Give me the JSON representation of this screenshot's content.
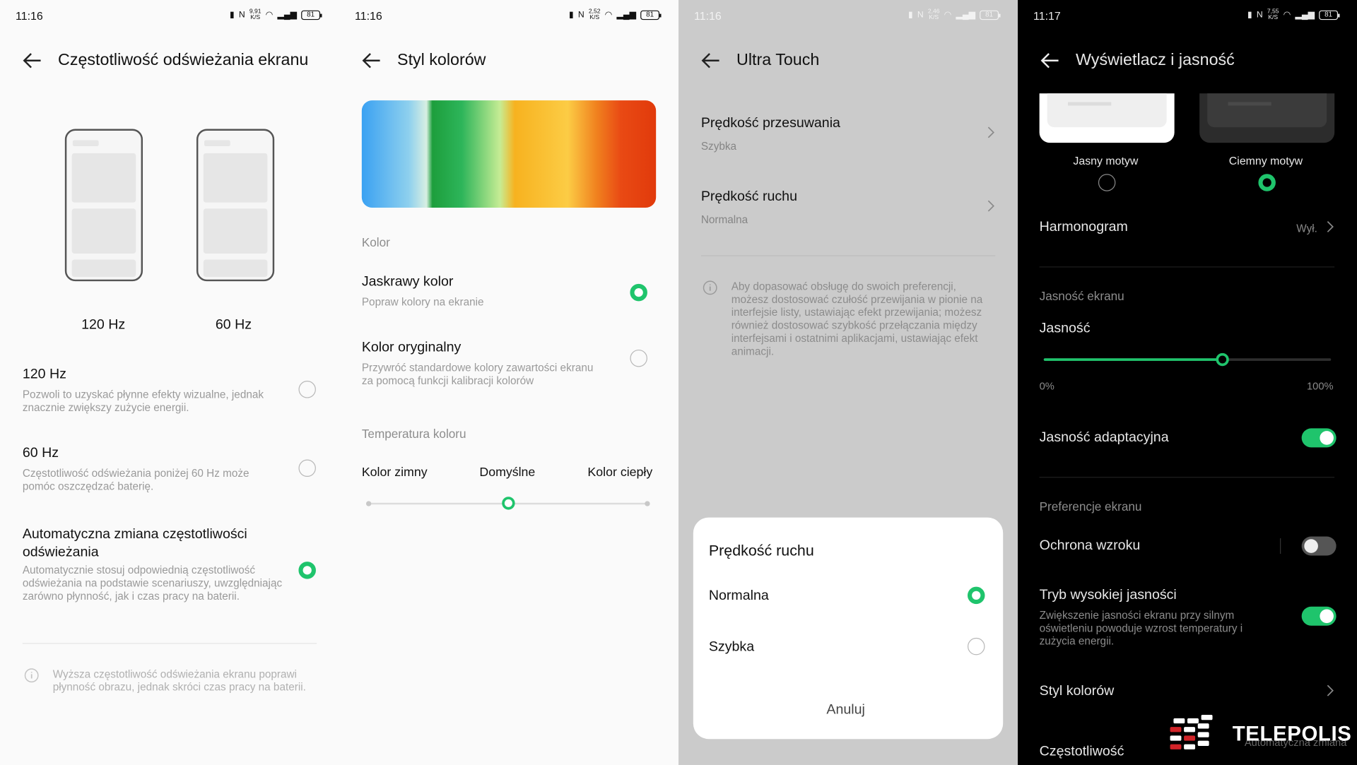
{
  "colors": {
    "accent": "#1fc46c",
    "dark_bg": "#000000",
    "light_bg": "#fafafa",
    "dimmed_bg": "#cbcbcb"
  },
  "p1": {
    "time": "11:16",
    "speed": "9,91",
    "speed_unit": "K/S",
    "battery": "81",
    "title": "Częstotliwość odświeżania ekranu",
    "phone_labels": [
      "120 Hz",
      "60 Hz"
    ],
    "options": [
      {
        "title": "120 Hz",
        "sub": "Pozwoli to uzyskać płynne efekty wizualne, jednak znacznie zwiększy zużycie energii.",
        "selected": false
      },
      {
        "title": "60 Hz",
        "sub": "Częstotliwość odświeżania poniżej 60 Hz może pomóc oszczędzać baterię.",
        "selected": false
      },
      {
        "title": "Automatyczna zmiana częstotliwości odświeżania",
        "sub": "Automatycznie stosuj odpowiednią częstotliwość odświeżania na podstawie scenariuszy, uwzględniając zarówno płynność, jak i czas pracy na baterii.",
        "selected": true
      }
    ],
    "note": "Wyższa częstotliwość odświeżania ekranu poprawi płynność obrazu, jednak skróci czas pracy na baterii."
  },
  "p2": {
    "time": "11:16",
    "speed": "2,52",
    "speed_unit": "K/S",
    "battery": "81",
    "title": "Styl kolorów",
    "section_color": "Kolor",
    "options": [
      {
        "title": "Jaskrawy kolor",
        "sub": "Popraw kolory na ekranie",
        "selected": true
      },
      {
        "title": "Kolor oryginalny",
        "sub": "Przywróć standardowe kolory zawartości ekranu za pomocą funkcji kalibracji kolorów",
        "selected": false
      }
    ],
    "section_temp": "Temperatura koloru",
    "temp_labels": [
      "Kolor zimny",
      "Domyślne",
      "Kolor ciepły"
    ],
    "temp_value": 0.5
  },
  "p3": {
    "time": "11:16",
    "speed": "2,46",
    "speed_unit": "K/S",
    "battery": "81",
    "title": "Ultra Touch",
    "rows": [
      {
        "title": "Prędkość przesuwania",
        "value": "Szybka"
      },
      {
        "title": "Prędkość ruchu",
        "value": "Normalna"
      }
    ],
    "note": "Aby dopasować obsługę do swoich preferencji, możesz dostosować czułość przewijania w pionie na interfejsie listy, ustawiając efekt przewijania; możesz również dostosować szybkość przełączania między interfejsami i ostatnimi aplikacjami, ustawiając efekt animacji.",
    "dialog": {
      "title": "Prędkość ruchu",
      "options": [
        {
          "label": "Normalna",
          "selected": true
        },
        {
          "label": "Szybka",
          "selected": false
        }
      ],
      "cancel": "Anuluj"
    }
  },
  "p4": {
    "time": "11:17",
    "speed": "7,55",
    "speed_unit": "K/S",
    "battery": "81",
    "title": "Wyświetlacz i jasność",
    "themes": [
      {
        "label": "Jasny motyw",
        "selected": false
      },
      {
        "label": "Ciemny motyw",
        "selected": true
      }
    ],
    "schedule": {
      "title": "Harmonogram",
      "value": "Wył."
    },
    "section_brightness": "Jasność ekranu",
    "brightness_label": "Jasność",
    "brightness_value": 0.62,
    "brightness_min": "0%",
    "brightness_max": "100%",
    "adaptive": {
      "title": "Jasność adaptacyjna",
      "on": true
    },
    "section_prefs": "Preferencje ekranu",
    "eye": {
      "title": "Ochrona wzroku",
      "on": false
    },
    "high": {
      "title": "Tryb wysokiej jasności",
      "sub": "Zwiększenie jasności ekranu przy silnym oświetleniu powoduje wzrost temperatury i zużycia energii.",
      "on": true
    },
    "color_style": "Styl kolorów",
    "refresh": "Częstotliwość",
    "refresh_value": "Automatyczna zmiana"
  },
  "watermark": "TELEPOLIS"
}
